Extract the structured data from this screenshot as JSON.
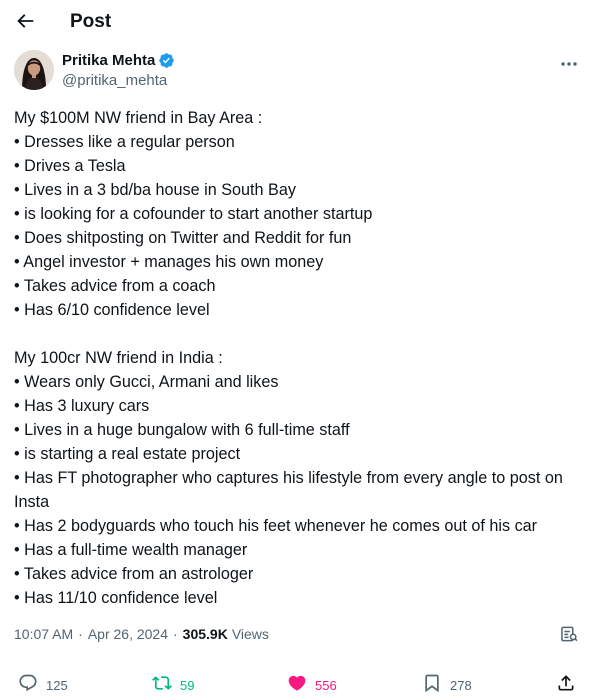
{
  "header": {
    "title": "Post"
  },
  "author": {
    "name": "Pritika Mehta",
    "handle": "@pritika_mehta",
    "verified": true,
    "verified_color": "#1d9bf0"
  },
  "tweet": {
    "lines": [
      "My $100M NW friend in Bay Area :",
      "• Dresses like a regular person",
      "• Drives a Tesla",
      "• Lives in a 3 bd/ba house in South Bay",
      "• is looking for a cofounder to start another startup",
      "• Does shitposting on Twitter and Reddit for fun",
      "• Angel investor + manages his own money",
      "• Takes advice from a coach",
      "• Has 6/10 confidence level",
      "",
      "My 100cr NW friend in India :",
      "• Wears only Gucci, Armani and likes",
      "• Has 3 luxury cars",
      "• Lives in a huge bungalow with 6 full-time staff",
      "• is starting a real estate project",
      "• Has FT photographer who captures his lifestyle from every angle to post on Insta",
      "• Has 2 bodyguards who touch his feet whenever he comes out of his car",
      "• Has a full-time wealth manager",
      "• Takes advice from an astrologer",
      "• Has 11/10 confidence level"
    ]
  },
  "meta": {
    "time": "10:07 AM",
    "separator": "·",
    "date": "Apr 26, 2024",
    "separator2": "·",
    "views_count": "305.9K",
    "views_label": "Views"
  },
  "actions": {
    "replies": "125",
    "reposts": "59",
    "likes": "556",
    "bookmarks": "278"
  },
  "colors": {
    "text": "#0f1419",
    "secondary": "#536471",
    "repost_active": "#00ba7c",
    "like_active": "#f91880"
  }
}
